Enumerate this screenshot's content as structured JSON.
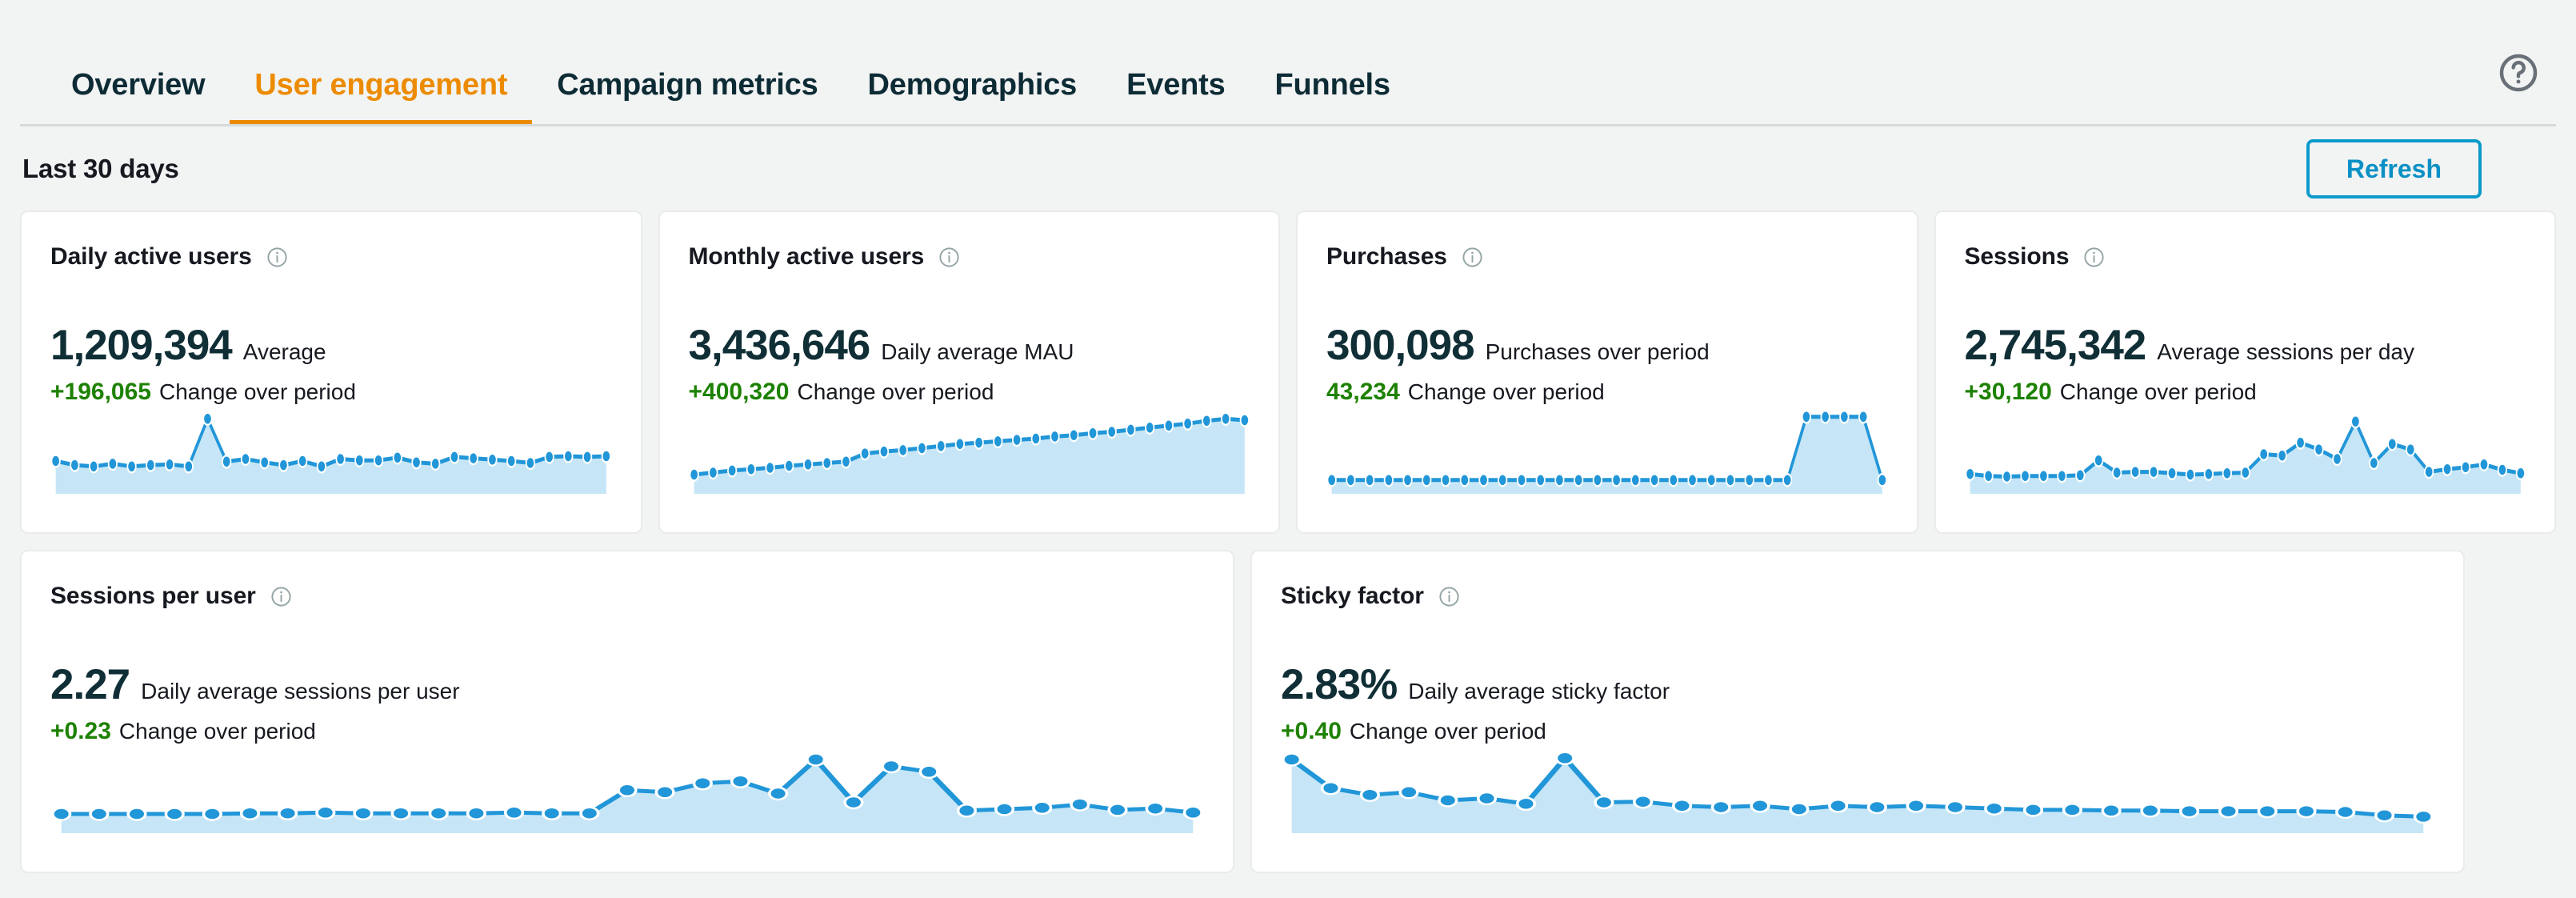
{
  "colors": {
    "accent_orange": "#ec8b00",
    "link_blue": "#0a90c4",
    "positive_green": "#1d8102",
    "text_dark": "#16191f",
    "spark_line": "#2196d8",
    "spark_fill": "#c6e6f7",
    "page_bg": "#f2f3f3",
    "card_bg": "#ffffff",
    "border": "#e9ebed"
  },
  "header": {
    "tabs": [
      {
        "label": "Overview",
        "active": false
      },
      {
        "label": "User engagement",
        "active": true
      },
      {
        "label": "Campaign metrics",
        "active": false
      },
      {
        "label": "Demographics",
        "active": false
      },
      {
        "label": "Events",
        "active": false
      },
      {
        "label": "Funnels",
        "active": false
      }
    ],
    "help_icon": "help-circle-icon"
  },
  "subheader": {
    "period_title": "Last 30 days",
    "refresh_label": "Refresh"
  },
  "cards": [
    {
      "title": "Daily active users",
      "info_icon": "info-icon",
      "value": "1,209,394",
      "value_label": "Average",
      "change": "+196,065",
      "change_label": "Change over period"
    },
    {
      "title": "Monthly active users",
      "info_icon": "info-icon",
      "value": "3,436,646",
      "value_label": "Daily average MAU",
      "change": "+400,320",
      "change_label": "Change over period"
    },
    {
      "title": "Purchases",
      "info_icon": "info-icon",
      "value": "300,098",
      "value_label": "Purchases over period",
      "change": "43,234",
      "change_label": "Change over period"
    },
    {
      "title": "Sessions",
      "info_icon": "info-icon",
      "value": "2,745,342",
      "value_label": "Average sessions per day",
      "change": "+30,120",
      "change_label": "Change over period"
    },
    {
      "title": "Sessions per user",
      "info_icon": "info-icon",
      "value": "2.27",
      "value_label": "Daily average sessions per user",
      "change": "+0.23",
      "change_label": "Change over period"
    },
    {
      "title": "Sticky factor",
      "info_icon": "info-icon",
      "value": "2.83%",
      "value_label": "Daily average sticky factor",
      "change": "+0.40",
      "change_label": "Change over period"
    }
  ],
  "chart_data": [
    {
      "type": "area",
      "title": "Daily active users",
      "ylabel": "Daily active users",
      "xlabel": "",
      "grid": false,
      "legend": "none",
      "ylim": [
        0,
        1
      ],
      "x": [
        0,
        1,
        2,
        3,
        4,
        5,
        6,
        7,
        8,
        9,
        10,
        11,
        12,
        13,
        14,
        15,
        16,
        17,
        18,
        19,
        20,
        21,
        22,
        23,
        24,
        25,
        26,
        27,
        28,
        29
      ],
      "values": [
        0.3,
        0.24,
        0.22,
        0.26,
        0.22,
        0.24,
        0.25,
        0.22,
        0.92,
        0.29,
        0.33,
        0.28,
        0.24,
        0.3,
        0.22,
        0.33,
        0.31,
        0.31,
        0.35,
        0.28,
        0.26,
        0.36,
        0.34,
        0.32,
        0.3,
        0.27,
        0.36,
        0.37,
        0.36,
        0.37
      ]
    },
    {
      "type": "area",
      "title": "Monthly active users",
      "ylabel": "Monthly active users",
      "xlabel": "",
      "grid": false,
      "legend": "none",
      "ylim": [
        0,
        1
      ],
      "x": [
        0,
        1,
        2,
        3,
        4,
        5,
        6,
        7,
        8,
        9,
        10,
        11,
        12,
        13,
        14,
        15,
        16,
        17,
        18,
        19,
        20,
        21,
        22,
        23,
        24,
        25,
        26,
        27,
        28,
        29
      ],
      "values": [
        0.1,
        0.13,
        0.16,
        0.18,
        0.2,
        0.23,
        0.25,
        0.27,
        0.29,
        0.41,
        0.44,
        0.46,
        0.49,
        0.52,
        0.55,
        0.57,
        0.59,
        0.61,
        0.63,
        0.66,
        0.68,
        0.71,
        0.73,
        0.76,
        0.79,
        0.82,
        0.85,
        0.89,
        0.92,
        0.9
      ]
    },
    {
      "type": "area",
      "title": "Purchases",
      "ylabel": "Purchases",
      "xlabel": "",
      "grid": false,
      "legend": "none",
      "ylim": [
        0,
        1
      ],
      "x": [
        0,
        1,
        2,
        3,
        4,
        5,
        6,
        7,
        8,
        9,
        10,
        11,
        12,
        13,
        14,
        15,
        16,
        17,
        18,
        19,
        20,
        21,
        22,
        23,
        24,
        25,
        26,
        27,
        28,
        29
      ],
      "values": [
        0.02,
        0.02,
        0.02,
        0.02,
        0.02,
        0.02,
        0.02,
        0.02,
        0.02,
        0.02,
        0.02,
        0.02,
        0.02,
        0.02,
        0.02,
        0.02,
        0.02,
        0.02,
        0.02,
        0.02,
        0.02,
        0.02,
        0.02,
        0.02,
        0.02,
        0.95,
        0.95,
        0.95,
        0.95,
        0.02
      ]
    },
    {
      "type": "area",
      "title": "Sessions",
      "ylabel": "Sessions",
      "xlabel": "",
      "grid": false,
      "legend": "none",
      "ylim": [
        0,
        1
      ],
      "x": [
        0,
        1,
        2,
        3,
        4,
        5,
        6,
        7,
        8,
        9,
        10,
        11,
        12,
        13,
        14,
        15,
        16,
        17,
        18,
        19,
        20,
        21,
        22,
        23,
        24,
        25,
        26,
        27,
        28,
        29
      ],
      "values": [
        0.11,
        0.08,
        0.07,
        0.08,
        0.08,
        0.08,
        0.09,
        0.31,
        0.13,
        0.14,
        0.14,
        0.12,
        0.1,
        0.11,
        0.12,
        0.13,
        0.4,
        0.38,
        0.57,
        0.47,
        0.33,
        0.88,
        0.27,
        0.55,
        0.47,
        0.14,
        0.18,
        0.21,
        0.25,
        0.17,
        0.12
      ]
    },
    {
      "type": "area",
      "title": "Sessions per user",
      "ylabel": "Sessions per user",
      "xlabel": "",
      "grid": false,
      "legend": "none",
      "ylim": [
        0,
        1
      ],
      "x": [
        0,
        1,
        2,
        3,
        4,
        5,
        6,
        7,
        8,
        9,
        10,
        11,
        12,
        13,
        14,
        15,
        16,
        17,
        18,
        19,
        20,
        21,
        22,
        23,
        24,
        25,
        26,
        27,
        28,
        29
      ],
      "values": [
        0.1,
        0.1,
        0.1,
        0.1,
        0.1,
        0.11,
        0.11,
        0.12,
        0.11,
        0.11,
        0.11,
        0.11,
        0.12,
        0.11,
        0.11,
        0.45,
        0.42,
        0.55,
        0.58,
        0.4,
        0.9,
        0.27,
        0.8,
        0.72,
        0.15,
        0.17,
        0.19,
        0.24,
        0.16,
        0.18,
        0.12
      ]
    },
    {
      "type": "area",
      "title": "Sticky factor",
      "ylabel": "Sticky factor",
      "xlabel": "",
      "grid": false,
      "legend": "none",
      "ylim": [
        0,
        1
      ],
      "x": [
        0,
        1,
        2,
        3,
        4,
        5,
        6,
        7,
        8,
        9,
        10,
        11,
        12,
        13,
        14,
        15,
        16,
        17,
        18,
        19,
        20,
        21,
        22,
        23,
        24,
        25,
        26,
        27,
        28,
        29
      ],
      "values": [
        0.9,
        0.48,
        0.38,
        0.42,
        0.3,
        0.33,
        0.25,
        0.92,
        0.27,
        0.28,
        0.22,
        0.2,
        0.22,
        0.17,
        0.22,
        0.2,
        0.22,
        0.2,
        0.18,
        0.16,
        0.16,
        0.15,
        0.15,
        0.14,
        0.14,
        0.14,
        0.14,
        0.13,
        0.08,
        0.06
      ]
    }
  ]
}
